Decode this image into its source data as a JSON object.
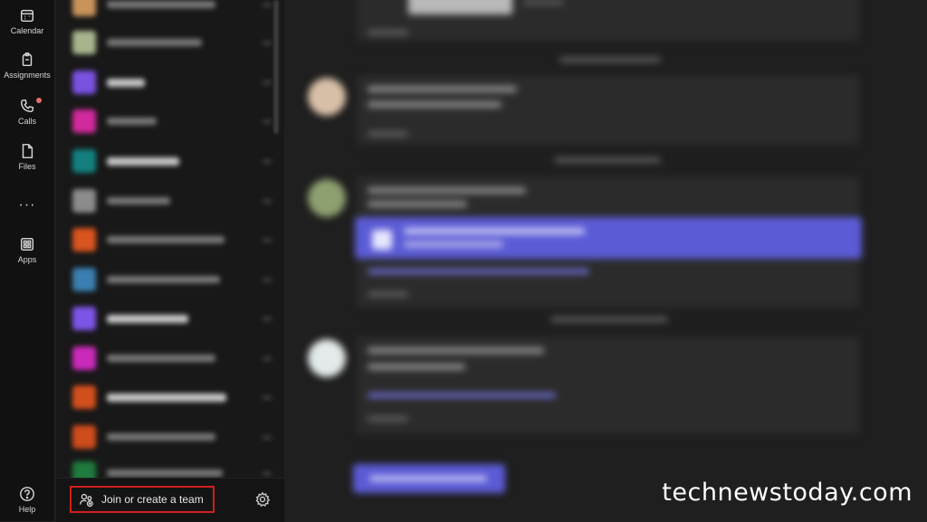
{
  "rail": {
    "items": [
      {
        "label": "Calendar",
        "icon": "calendar-icon"
      },
      {
        "label": "Assignments",
        "icon": "assignments-icon"
      },
      {
        "label": "Calls",
        "icon": "calls-icon",
        "notification_dot": true
      },
      {
        "label": "Files",
        "icon": "files-icon"
      },
      {
        "label": "Apps",
        "icon": "apps-icon"
      }
    ],
    "more_label": "···",
    "help_label": "Help"
  },
  "teams_panel": {
    "join_label": "Join or create a team",
    "join_icon": "people-add-icon",
    "settings_icon": "gear-icon",
    "highlight_color": "#d21e1e"
  },
  "watermark": "technewstoday.com",
  "colors": {
    "rail_bg": "#111112",
    "panel_bg": "#181818",
    "canvas_bg": "#1f1f1f",
    "accent": "#5b5bd6"
  }
}
